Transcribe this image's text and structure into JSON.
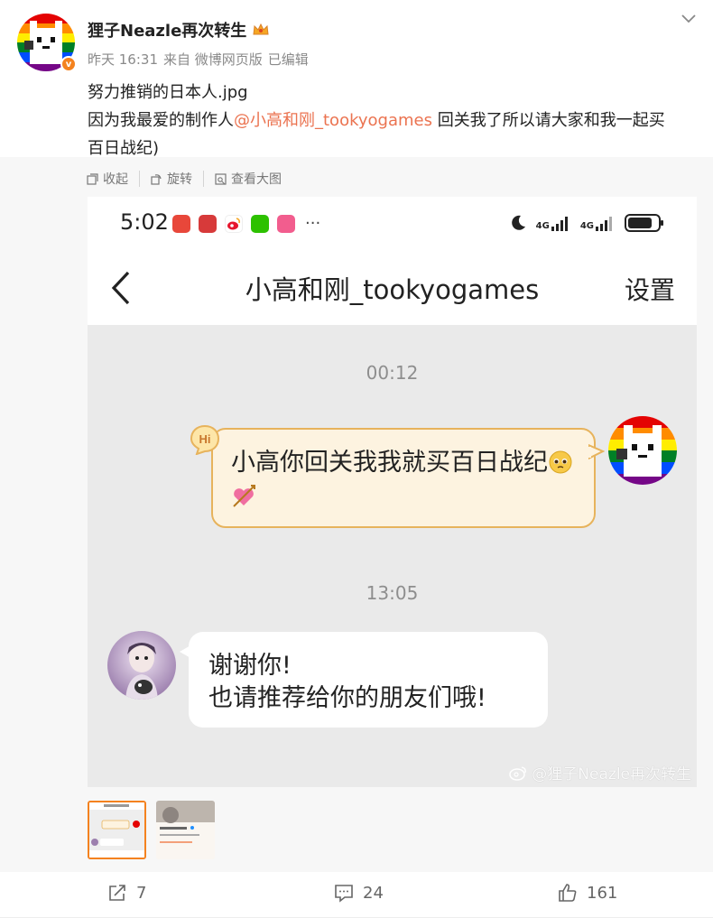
{
  "post": {
    "username": "狸子Neazle再次转生",
    "time": "昨天 16:31",
    "source": "来自 微博网页版",
    "edited": "已编辑",
    "line1": "努力推销的日本人.jpg",
    "line2_prefix": "因为我最爱的制作人",
    "mention": "@小高和刚_tookyogames",
    "line2_suffix": " 回关我了所以请大家和我一起买",
    "line3": "百日战纪)"
  },
  "media_toolbar": {
    "collapse": "收起",
    "rotate": "旋转",
    "view_large": "查看大图"
  },
  "screenshot": {
    "status_time": "5:02",
    "more": "···",
    "net1": "4G",
    "net2": "4G",
    "chat_title": "小高和刚_tookyogames",
    "settings": "设置",
    "timestamp1": "00:12",
    "outgoing_message": "小高你回关我我就买百日战纪",
    "hi_badge": "Hi",
    "timestamp2": "13:05",
    "incoming_line1": "谢谢你!",
    "incoming_line2": "也请推荐给你的朋友们哦!",
    "watermark": "@狸子Neazle再次转生"
  },
  "actions": {
    "repost_count": "7",
    "comment_count": "24",
    "like_count": "161"
  },
  "icons": [
    "verified-badge-icon",
    "crown-icon",
    "chevron-down-icon",
    "collapse-icon",
    "rotate-icon",
    "view-large-icon",
    "back-arrow-icon",
    "moon-icon",
    "battery-icon",
    "repost-icon",
    "comment-icon",
    "like-icon",
    "weibo-logo-icon"
  ],
  "colors": {
    "mention": "#eb7350",
    "accent": "#f4821f",
    "bubble_border": "#e7b35c",
    "bubble_fill": "#fdf3e0"
  }
}
